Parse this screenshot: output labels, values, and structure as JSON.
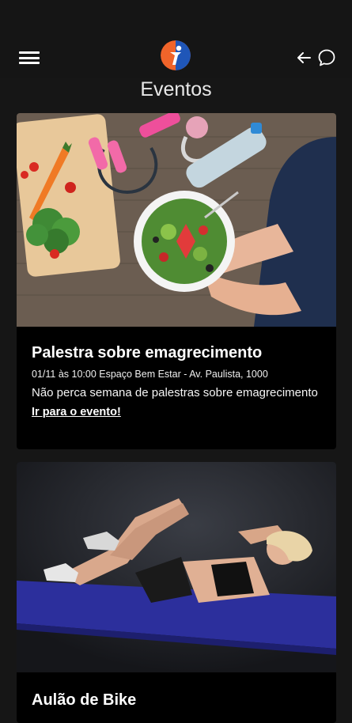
{
  "header": {
    "menu_icon": "hamburger-menu-icon",
    "logo_icon": "app-logo-icon",
    "back_icon": "back-arrow-icon",
    "chat_icon": "chat-bubble-icon"
  },
  "page": {
    "title": "Eventos"
  },
  "events": [
    {
      "title": "Palestra sobre emagrecimento",
      "meta": "01/11 às 10:00 Espaço Bem Estar - Av. Paulista, 1000",
      "description": "Não perca semana de palestras sobre emagrecimento",
      "link": "Ir para o evento!"
    },
    {
      "title": "Aulão de Bike"
    }
  ],
  "colors": {
    "background": "#161616",
    "card": "#000000",
    "logo_orange": "#f0642a",
    "logo_blue": "#1f56b8"
  }
}
